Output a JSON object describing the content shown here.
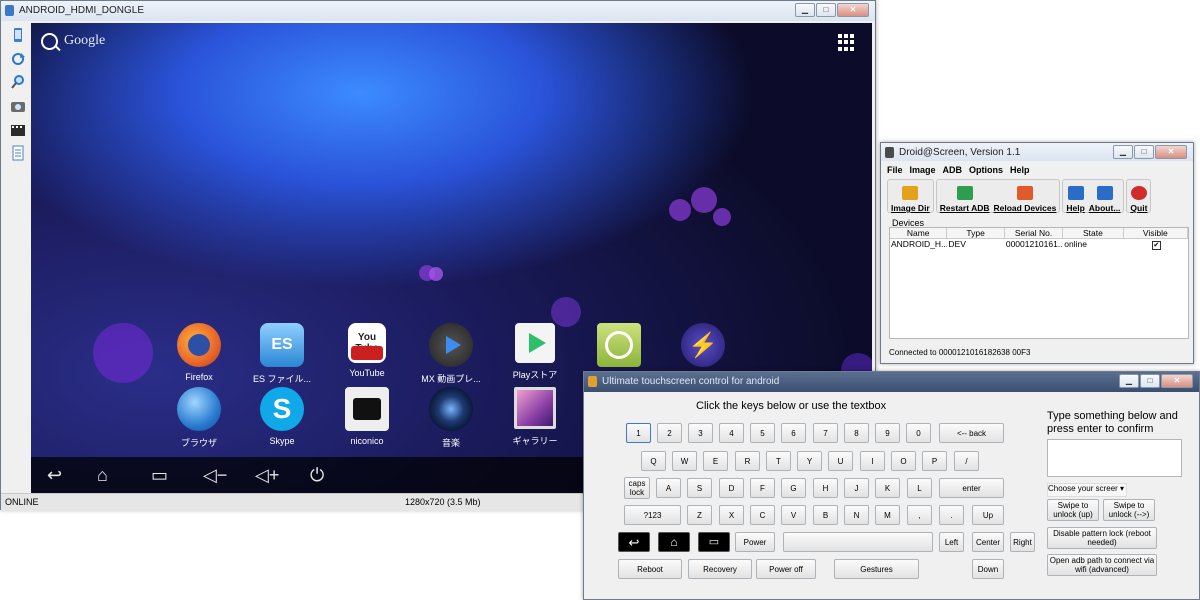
{
  "main_window": {
    "title": "ANDROID_HDMI_DONGLE",
    "status_left": "ONLINE",
    "status_center": "1280x720 (3.5 Mb)",
    "side_tools": [
      "phone-icon",
      "refresh-icon",
      "zoom-icon",
      "screenshot-icon",
      "video-icon",
      "document-icon"
    ]
  },
  "android": {
    "search_label": "Google",
    "apps_row1": [
      {
        "label": "Firefox",
        "icon": "firefox-icon",
        "color": "#e8652b"
      },
      {
        "label": "ES ファイル...",
        "icon": "es-file-icon",
        "color": "#4aa3df"
      },
      {
        "label": "YouTube",
        "icon": "youtube-icon",
        "color": "#cc1f1f",
        "text": "You Tube"
      },
      {
        "label": "MX 動画プレ...",
        "icon": "mx-player-icon",
        "color": "#2d6dd8"
      },
      {
        "label": "Playストア",
        "icon": "play-store-icon",
        "color": "#f2f2f2"
      },
      {
        "label": "",
        "icon": "market-icon",
        "color": "#a7c94a"
      },
      {
        "label": "",
        "icon": "flash-icon",
        "color": "#3a2f8a"
      }
    ],
    "apps_row2": [
      {
        "label": "ブラウザ",
        "icon": "browser-globe-icon",
        "color": "#2a7bd0"
      },
      {
        "label": "Skype",
        "icon": "skype-icon",
        "color": "#10a8e8",
        "text": "S"
      },
      {
        "label": "niconico",
        "icon": "niconico-icon",
        "color": "#e8e8e8"
      },
      {
        "label": "音楽",
        "icon": "music-speaker-icon",
        "color": "#1e3a72"
      },
      {
        "label": "ギャラリー",
        "icon": "gallery-icon",
        "color": "#8a3fa6"
      }
    ],
    "nav_icons": [
      "back-icon",
      "home-icon",
      "recent-apps-icon",
      "volume-down-icon",
      "volume-up-icon",
      "power-icon"
    ]
  },
  "droid_screen": {
    "title": "Droid@Screen, Version 1.1",
    "menu": [
      "File",
      "Image",
      "ADB",
      "Options",
      "Help"
    ],
    "toolbar": [
      {
        "label": "Image Dir",
        "icon": "folder-icon",
        "color": "#e3a21a"
      },
      {
        "label": "Restart ADB",
        "icon": "restart-icon",
        "color": "#2d9e4e"
      },
      {
        "label": "Reload Devices",
        "icon": "reload-icon",
        "color": "#e05a2b"
      },
      {
        "label": "Help",
        "icon": "help-icon",
        "color": "#2a6cc8"
      },
      {
        "label": "About...",
        "icon": "info-icon",
        "color": "#2a6cc8"
      },
      {
        "label": "Quit",
        "icon": "quit-icon",
        "color": "#d22b2b"
      }
    ],
    "devices_label": "Devices",
    "columns": [
      "Name",
      "Type",
      "Serial No.",
      "State",
      "Visible"
    ],
    "row": {
      "name": "ANDROID_H...",
      "type": "DEV",
      "serial": "00001210161...",
      "state": "online",
      "visible": "✔"
    },
    "status": "Connected to 0000121016182638 00F3"
  },
  "touch": {
    "title": "Ultimate touchscreen control for android",
    "kb_hint": "Click the keys below or use the textbox",
    "type_hint": "Type something below and press enter to confirm",
    "row1": [
      "1",
      "2",
      "3",
      "4",
      "5",
      "6",
      "7",
      "8",
      "9",
      "0"
    ],
    "back": "<-- back",
    "row2": [
      "Q",
      "W",
      "E",
      "R",
      "T",
      "Y",
      "U",
      "I",
      "O",
      "P",
      "/"
    ],
    "caps": "caps lock",
    "row3": [
      "A",
      "S",
      "D",
      "F",
      "G",
      "H",
      "J",
      "K",
      "L"
    ],
    "enter": "enter",
    "sym": "?123",
    "row4": [
      "Z",
      "X",
      "C",
      "V",
      "B",
      "N",
      "M",
      ",",
      "."
    ],
    "up": "Up",
    "power": "Power",
    "left": "Left",
    "center": "Center",
    "right": "Right",
    "reboot": "Reboot",
    "recovery": "Recovery",
    "poweroff": "Power off",
    "gestures": "Gestures",
    "down": "Down",
    "choose_screen": "Choose your screer",
    "swipe_up": "Swipe to unlock (up)",
    "swipe_lr": "Swipe to unlock (-->)",
    "disable_lock": "Disable pattern lock (reboot needed)",
    "adb_path": "Open adb path to connect via wifi (advanced)"
  }
}
